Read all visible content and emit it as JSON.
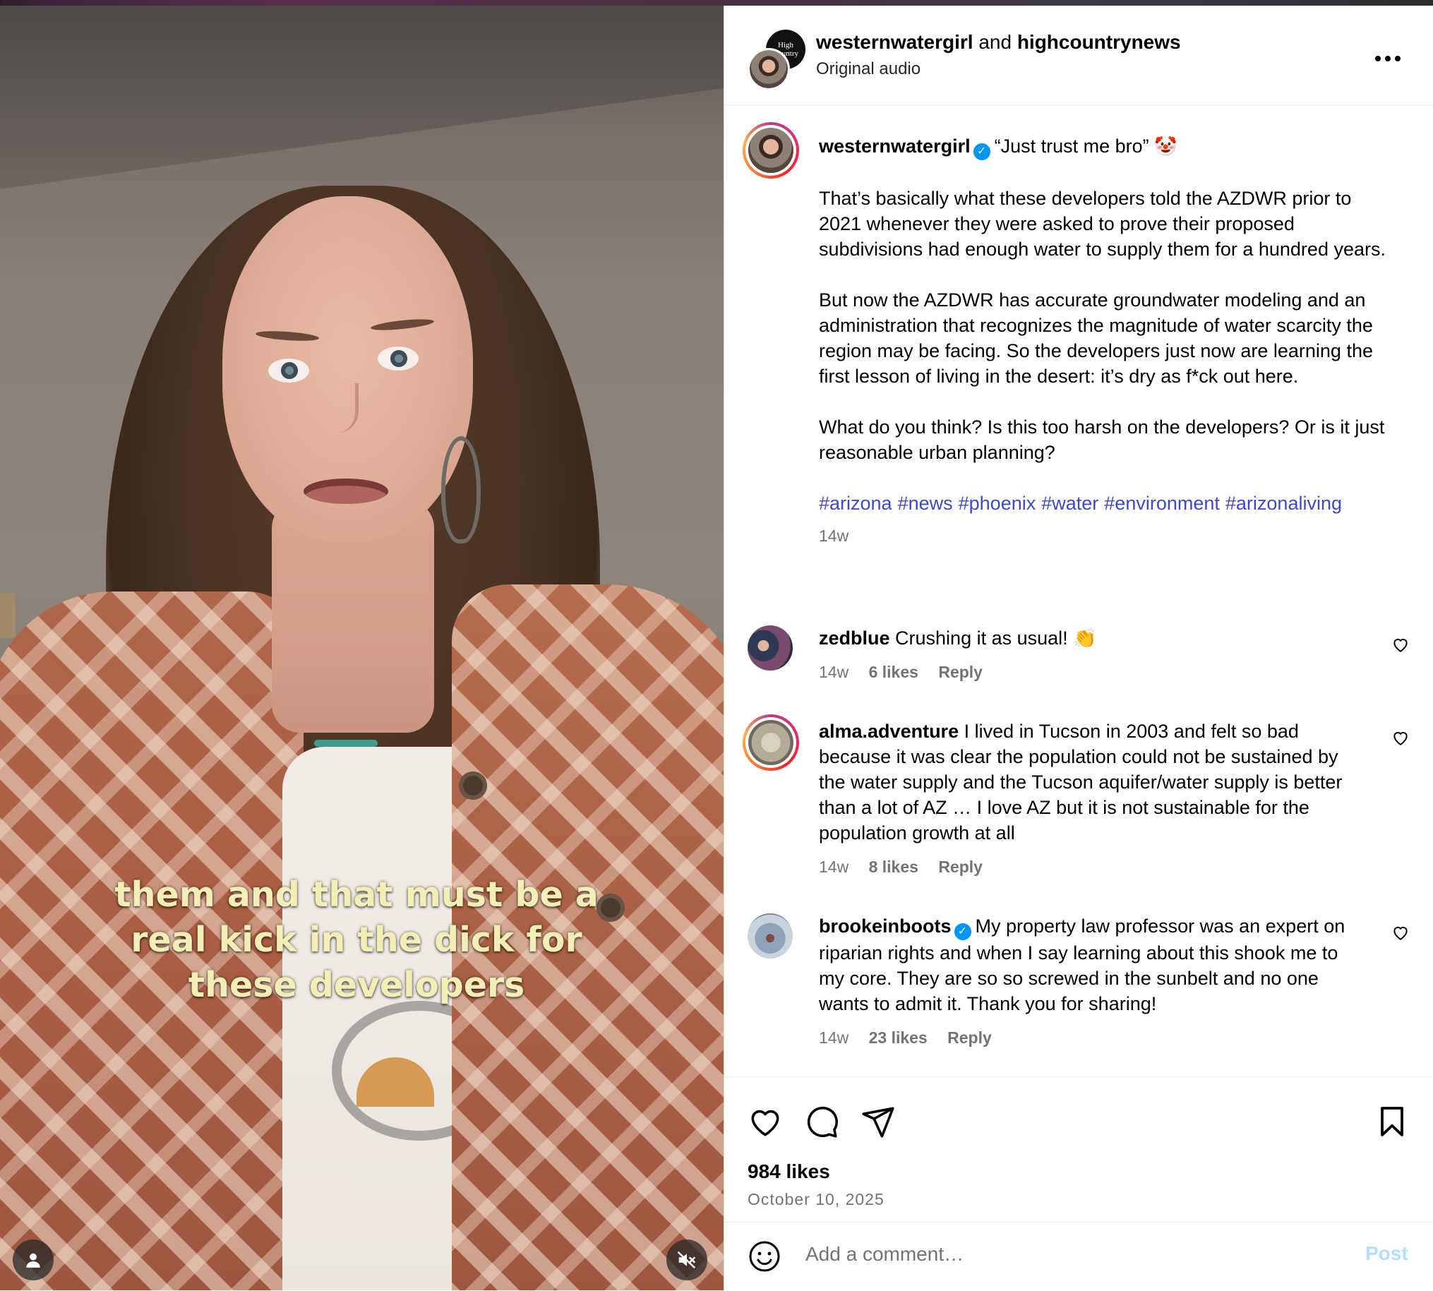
{
  "post": {
    "header": {
      "author_primary": "westernwatergirl",
      "joiner": "and",
      "author_secondary": "highcountrynews",
      "audio": "Original audio",
      "collab_logo_text": "High Country"
    },
    "caption": {
      "username": "westernwatergirl",
      "title": "“Just trust me bro”",
      "title_emoji": "🤡",
      "paragraphs": [
        "That’s basically what these developers told the AZDWR prior to 2021 whenever they were asked to prove their proposed subdivisions had enough water to supply them for a hundred years.",
        "But now the AZDWR has accurate groundwater modeling and an administration that recognizes the magnitude of water scarcity the region may be facing. So the developers just now are learning the first lesson of living in the desert: it’s dry as f*ck out here.",
        "What do you think? Is this too harsh on the developers? Or is it just reasonable urban planning?"
      ],
      "hashtags": [
        "#arizona",
        "#news",
        "#phoenix",
        "#water",
        "#environment",
        "#arizonaliving"
      ],
      "time": "14w"
    },
    "comments": [
      {
        "username": "zedblue",
        "verified": false,
        "text": "Crushing it as usual!",
        "emoji": "👏",
        "time": "14w",
        "likes": "6 likes",
        "reply": "Reply"
      },
      {
        "username": "alma.adventure",
        "verified": false,
        "text": "I lived in Tucson in 2003 and felt so bad because it was clear the population could not be sustained by the water supply and the Tucson aquifer/water supply is better than a lot of AZ … I love AZ but it is not sustainable for the population growth at all",
        "emoji": "",
        "time": "14w",
        "likes": "8 likes",
        "reply": "Reply"
      },
      {
        "username": "brookeinboots",
        "verified": true,
        "text": "My property law professor was an expert on riparian rights and when I say learning about this shook me to my core. They are so so screwed in the sunbelt and no one wants to admit it. Thank you for sharing!",
        "emoji": "",
        "time": "14w",
        "likes": "23 likes",
        "reply": "Reply"
      }
    ],
    "likes_count": "984 likes",
    "date": "October 10, 2025",
    "add_comment_placeholder": "Add a comment…",
    "post_button": "Post"
  },
  "video": {
    "subtitle": "them and that must be a real kick in the dick for these developers",
    "muted": true
  },
  "colors": {
    "link": "#3b48d6",
    "verified": "#0095f6",
    "post_button_disabled": "#b2dffc",
    "secondary_text": "#737373"
  },
  "icons": {
    "more": "more-options-icon",
    "like": "heart-icon",
    "comment": "comment-bubble-icon",
    "share": "paper-plane-icon",
    "save": "bookmark-icon",
    "emoji": "emoji-smiley-icon",
    "mute": "muted-speaker-icon",
    "tagged_users": "person-icon"
  }
}
